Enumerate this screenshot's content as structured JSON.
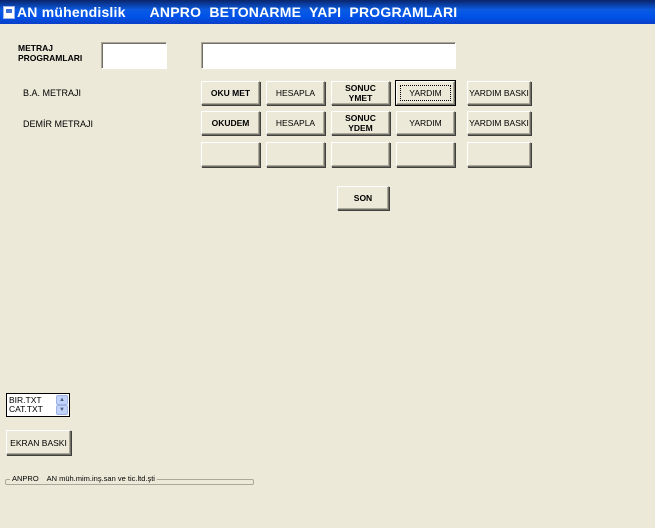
{
  "titlebar": {
    "title": "AN mühendislik      ANPRO  BETONARME  YAPI  PROGRAMLARI",
    "icon": "app-icon"
  },
  "form": {
    "metraj_label_line1": "METRAJ",
    "metraj_label_line2": "PROGRAMLARI",
    "metraj_code_value": "",
    "metraj_desc_value": ""
  },
  "rows": [
    {
      "label": "B.A. METRAJI",
      "buttons": [
        "OKU  MET",
        "HESAPLA",
        "SONUC YMET",
        "YARDIM",
        "YARDIM BASKI"
      ],
      "sonuc_line1": "SONUC",
      "sonuc_line2": "YMET"
    },
    {
      "label": "DEMİR METRAJI",
      "buttons": [
        "OKUDEM",
        "HESAPLA",
        "SONUC YDEM",
        "YARDIM",
        "YARDIM BASKI"
      ],
      "sonuc_line1": "SONUC",
      "sonuc_line2": "YDEM"
    }
  ],
  "son_button": "SON",
  "file_list": {
    "items": [
      "BIR.TXT",
      "CAT.TXT"
    ]
  },
  "ekran_baski_button": "EKRAN BASKI",
  "status": {
    "text": "ANPRO    AN müh.mim.inş.san ve tic.ltd.şti"
  }
}
